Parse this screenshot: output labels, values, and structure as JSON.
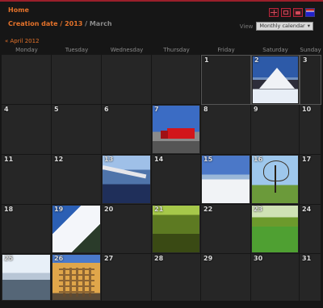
{
  "header": {
    "home": "Home",
    "breadcrumb": {
      "part1": "Creation date",
      "sep1": " / ",
      "part2": "2013",
      "sep2": " / ",
      "current": "March"
    },
    "view_label": "View",
    "view_value": "Monthly calendar",
    "view_arrow": "▾",
    "icons": [
      "expand-icon",
      "collapse-icon",
      "slideshow-icon",
      "flag-icon"
    ]
  },
  "prev_month": "« April 2012",
  "weekdays": [
    "Monday",
    "Tuesday",
    "Wednesday",
    "Thursday",
    "Friday",
    "Saturday",
    "Sunday"
  ],
  "days": [
    {
      "day": ""
    },
    {
      "day": ""
    },
    {
      "day": ""
    },
    {
      "day": ""
    },
    {
      "day": "1"
    },
    {
      "day": "2",
      "photo": "ph-mountain"
    },
    {
      "day": "3"
    },
    {
      "day": "4"
    },
    {
      "day": "5"
    },
    {
      "day": "6"
    },
    {
      "day": "7",
      "photo": "ph-truck"
    },
    {
      "day": "8"
    },
    {
      "day": "9"
    },
    {
      "day": "10"
    },
    {
      "day": "11"
    },
    {
      "day": "12"
    },
    {
      "day": "13",
      "photo": "ph-plane"
    },
    {
      "day": "14"
    },
    {
      "day": "15",
      "photo": "ph-snow"
    },
    {
      "day": "16",
      "photo": "ph-tree"
    },
    {
      "day": "17"
    },
    {
      "day": "18"
    },
    {
      "day": "19",
      "photo": "ph-snowtrees"
    },
    {
      "day": "20"
    },
    {
      "day": "21",
      "photo": "ph-forest"
    },
    {
      "day": "22"
    },
    {
      "day": "23",
      "photo": "ph-park"
    },
    {
      "day": "24"
    },
    {
      "day": "25",
      "photo": "ph-lake"
    },
    {
      "day": "26",
      "photo": "ph-building"
    },
    {
      "day": "27"
    },
    {
      "day": "28"
    },
    {
      "day": "29"
    },
    {
      "day": "30"
    },
    {
      "day": "31"
    }
  ]
}
